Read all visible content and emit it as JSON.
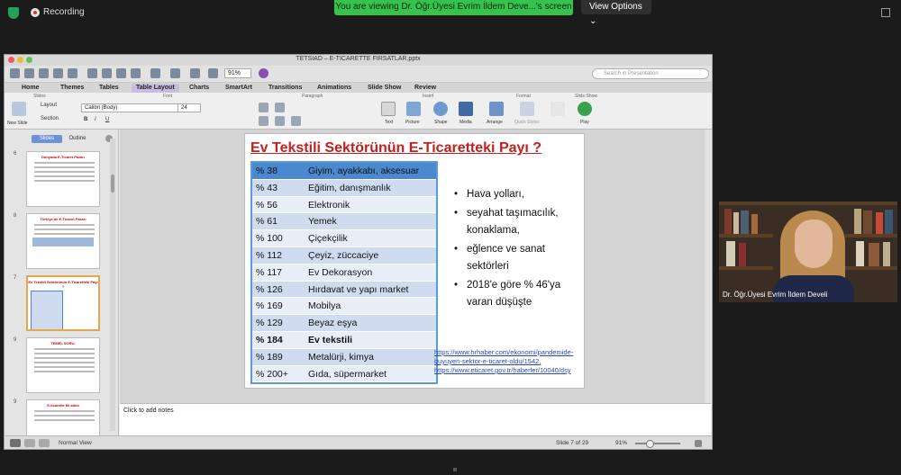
{
  "zoom": {
    "recording_label": "Recording",
    "viewing_label": "You are viewing Dr. Öğr.Üyesi Evrim İldem Deve...'s screen",
    "view_options_label": "View Options ⌄"
  },
  "ppt": {
    "window_title": "TETSİAD – E-TİCARETTE FIRSATLAR.pptx",
    "zoom_value": "91%",
    "search_placeholder": "Search in Presentation",
    "tabs": [
      "Home",
      "Themes",
      "Tables",
      "Table Layout",
      "Charts",
      "SmartArt",
      "Transitions",
      "Animations",
      "Slide Show",
      "Review"
    ],
    "active_tab": "Table Layout",
    "ribbon_groups": [
      "Slides",
      "Font",
      "Paragraph",
      "Insert",
      "Format",
      "Slide Show"
    ],
    "ribbon": {
      "new_slide": "New Slide",
      "layout": "Layout",
      "section": "Section",
      "font_name": "Calibri (Body)",
      "font_size": "24",
      "text": "Text",
      "picture": "Picture",
      "shape": "Shape",
      "media": "Media",
      "arrange": "Arrange",
      "quick_styles": "Quick Styles",
      "play": "Play"
    },
    "sidebar": {
      "tab_slides": "Slides",
      "tab_outline": "Outline",
      "thumbnails": [
        {
          "num": "6",
          "title": "Dünyada E-Ticaret Pazarı",
          "selected": false
        },
        {
          "num": "8",
          "title": "Türkiye'de E-Ticaret Pazarı",
          "selected": false
        },
        {
          "num": "7",
          "title": "Ev Tekstili Sektörünün E-Ticaretteki Payı ?",
          "selected": true
        },
        {
          "num": "9",
          "title": "TEMEL SORU:",
          "selected": false
        },
        {
          "num": "9",
          "title": "E-ticarette İlk adım",
          "selected": false
        }
      ]
    },
    "slide": {
      "title": "Ev Tekstili Sektörünün E-Ticaretteki Payı ?",
      "rows": [
        {
          "pct": "% 38",
          "sector": "Giyim, ayakkabı, aksesuar"
        },
        {
          "pct": "% 43",
          "sector": "Eğitim, danışmanlık"
        },
        {
          "pct": "% 56",
          "sector": "Elektronik"
        },
        {
          "pct": "% 61",
          "sector": "Yemek"
        },
        {
          "pct": "% 100",
          "sector": "Çiçekçilik"
        },
        {
          "pct": "% 112",
          "sector": "Çeyiz, züccaciye"
        },
        {
          "pct": "% 117",
          "sector": "Ev Dekorasyon"
        },
        {
          "pct": "% 126",
          "sector": "Hırdavat ve yapı market"
        },
        {
          "pct": "% 169",
          "sector": "Mobilya"
        },
        {
          "pct": "% 129",
          "sector": "Beyaz eşya"
        },
        {
          "pct": "% 184",
          "sector": "Ev tekstili"
        },
        {
          "pct": "% 189",
          "sector": "Metalürji, kimya"
        },
        {
          "pct": "% 200+",
          "sector": "Gıda, süpermarket"
        }
      ],
      "bullets": [
        "Hava yolları,",
        "seyahat taşımacılık, konaklama,",
        "eğlence ve sanat sektörleri",
        "2018'e göre % 46'ya varan düşüşte"
      ],
      "links": [
        "https://www.hrhaber.com/ekonomi/pandemide-buyuyen-sektor-e-ticaret-oldu/1542,",
        "https://www.eticaret.gov.tr/haberler/10040/dsy"
      ]
    },
    "notes_placeholder": "Click to add notes",
    "status": {
      "view": "Normal View",
      "slide_counter": "Slide 7 of 29",
      "zoom": "91%"
    }
  },
  "camera": {
    "participant_name": "Dr. Öğr.Üyesi Evrim İldem Develi"
  },
  "colors": {
    "zoom_green": "#37c24e",
    "title_red": "#c41e1e",
    "table_header": "#4a88cf",
    "table_row_odd": "#cfdcef",
    "table_row_even": "#e8eef8"
  }
}
